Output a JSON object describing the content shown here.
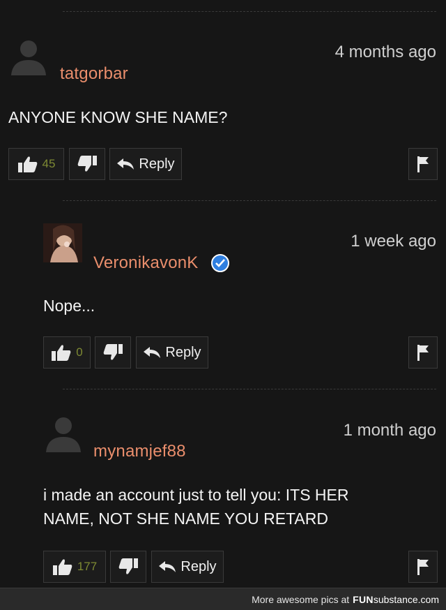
{
  "comments": [
    {
      "username": "tatgorbar",
      "timestamp": "4 months ago",
      "text_lines": [
        "ANYONE KNOW SHE NAME?"
      ],
      "likes": "45",
      "reply_label": "Reply",
      "verified": false
    },
    {
      "username": "VeronikavonK",
      "timestamp": "1 week ago",
      "text_lines": [
        "Nope..."
      ],
      "likes": "0",
      "reply_label": "Reply",
      "verified": true
    },
    {
      "username": "mynamjef88",
      "timestamp": "1 month ago",
      "text_lines": [
        "i made an account just to tell you: ITS HER",
        "NAME, NOT SHE NAME YOU RETARD"
      ],
      "likes": "177",
      "reply_label": "Reply",
      "verified": false
    }
  ],
  "footer": {
    "text": "More awesome pics at",
    "brand_part1": "FUN",
    "brand_part2": "substance.com"
  },
  "colors": {
    "background": "#161616",
    "username": "#ea8e6c",
    "like_count": "#7e8a33",
    "verified_badge": "#2f7fe0"
  },
  "icons": [
    "user-silhouette-icon",
    "thumbs-up-icon",
    "thumbs-down-icon",
    "reply-arrow-icon",
    "flag-icon",
    "verified-check-icon"
  ]
}
